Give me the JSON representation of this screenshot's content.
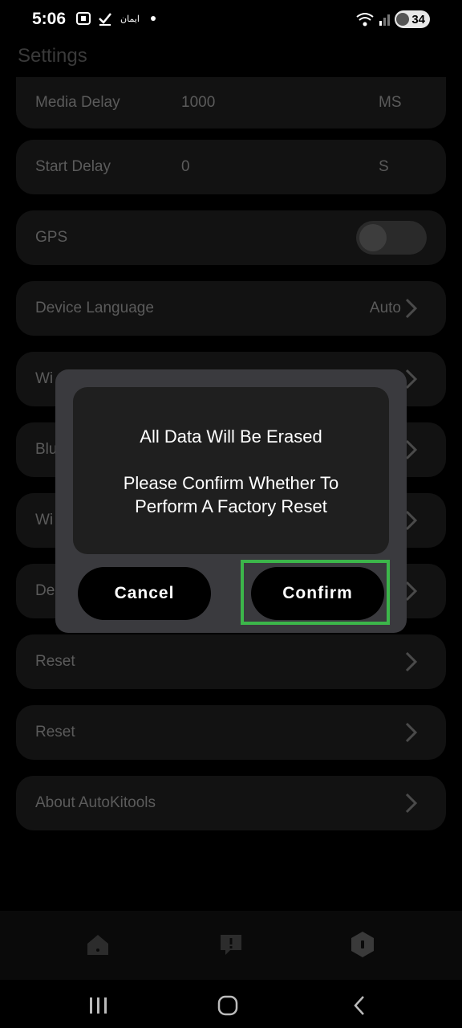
{
  "status_bar": {
    "time": "5:06",
    "carrier": "ايمان",
    "battery": "34"
  },
  "page": {
    "title": "Settings"
  },
  "settings": {
    "media_delay": {
      "label": "Media Delay",
      "value": "1000",
      "unit": "MS"
    },
    "start_delay": {
      "label": "Start Delay",
      "value": "0",
      "unit": "S"
    },
    "gps": {
      "label": "GPS",
      "enabled": false
    },
    "device_language": {
      "label": "Device Language",
      "value": "Auto"
    },
    "row5_label": "Wi",
    "row6_label": "Blu",
    "row7_label": "Wi",
    "row8_label": "De",
    "reset1": {
      "label": "Reset"
    },
    "reset2": {
      "label": "Reset"
    },
    "about": {
      "label": "About AutoKitools"
    }
  },
  "dialog": {
    "title": "All Data Will Be Erased",
    "message": "Please Confirm Whether To Perform A Factory Reset",
    "cancel_label": "Cancel",
    "confirm_label": "Confirm"
  },
  "bottom_nav": {
    "items": [
      {
        "icon": "home-icon"
      },
      {
        "icon": "feedback-icon"
      },
      {
        "icon": "settings-hex-icon"
      }
    ]
  },
  "colors": {
    "highlight": "#3cb64a",
    "dialog_bg": "#3a3a3e",
    "button_bg": "#000000"
  }
}
